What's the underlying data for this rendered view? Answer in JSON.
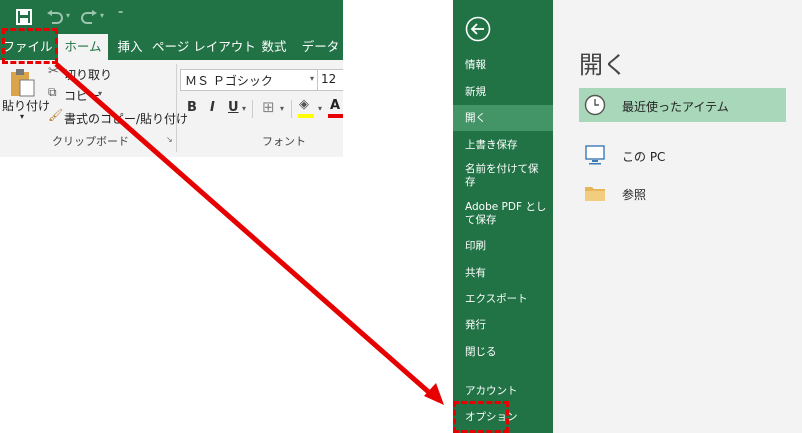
{
  "ribbon": {
    "tabs": [
      "ファイル",
      "ホーム",
      "挿入",
      "ページ レイアウト",
      "数式",
      "データ"
    ],
    "clipboard": {
      "paste_label": "貼り付け",
      "cut_label": "切り取り",
      "copy_label": "コピー",
      "format_painter_label": "書式のコピー/貼り付け",
      "group_label": "クリップボード"
    },
    "font": {
      "font_name": "ＭＳ Ｐゴシック",
      "font_size": "12",
      "bold_label": "B",
      "italic_label": "I",
      "underline_label": "U",
      "font_color_label": "A",
      "group_label": "フォント"
    }
  },
  "backstage": {
    "nav_items": [
      "情報",
      "新規",
      "開く",
      "上書き保存",
      "名前を付けて保存",
      "Adobe PDF として保存",
      "印刷",
      "共有",
      "エクスポート",
      "発行",
      "閉じる",
      "アカウント",
      "オプション"
    ],
    "title": "開く",
    "locations": [
      "最近使ったアイテム",
      "この PC",
      "参照"
    ]
  },
  "colors": {
    "excel_green": "#217346",
    "highlight_red": "#e60000",
    "selected_nav": "#439467",
    "selected_location": "#a8d8b9"
  },
  "icons": [
    "save-icon",
    "undo-icon",
    "redo-icon",
    "back-arrow-icon",
    "clock-icon",
    "computer-icon",
    "folder-icon"
  ]
}
